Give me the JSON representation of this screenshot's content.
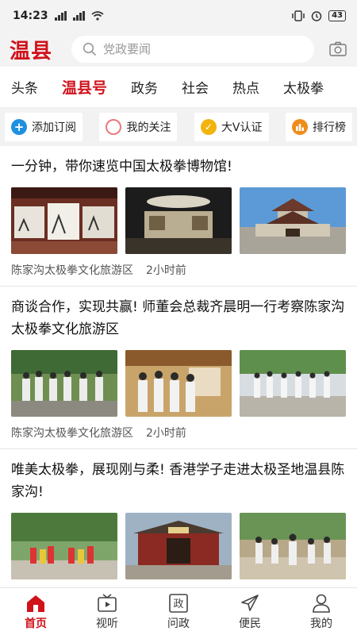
{
  "status_bar": {
    "time": "14:23",
    "signal1": "4G",
    "signal2": "4G",
    "battery": "43"
  },
  "header": {
    "logo": "温县",
    "search_placeholder": "党政要闻"
  },
  "tabs": [
    {
      "label": "头条"
    },
    {
      "label": "温县号"
    },
    {
      "label": "政务"
    },
    {
      "label": "社会"
    },
    {
      "label": "热点"
    },
    {
      "label": "太极拳"
    }
  ],
  "actions": [
    {
      "label": "添加订阅",
      "icon": "plus-icon",
      "color": "#1e90e0"
    },
    {
      "label": "我的关注",
      "icon": "circle-icon",
      "color": "#e9787c"
    },
    {
      "label": "大V认证",
      "icon": "verified-icon",
      "color": "#f2b30c"
    },
    {
      "label": "排行榜",
      "icon": "ranking-icon",
      "color": "#f08c1b"
    }
  ],
  "articles": [
    {
      "title": "一分钟，带你速览中国太极拳博物馆!",
      "source": "陈家沟太极拳文化旅游区",
      "time": "2小时前"
    },
    {
      "title": "商谈合作，实现共赢! 师董会总裁齐晨明一行考察陈家沟太极拳文化旅游区",
      "source": "陈家沟太极拳文化旅游区",
      "time": "2小时前"
    },
    {
      "title": "唯美太极拳，展现刚与柔! 香港学子走进太极圣地温县陈家沟!",
      "source": "",
      "time": ""
    }
  ],
  "bottom_nav": [
    {
      "label": "首页",
      "icon": "home-icon"
    },
    {
      "label": "视听",
      "icon": "tv-icon"
    },
    {
      "label": "问政",
      "icon": "politics-icon"
    },
    {
      "label": "便民",
      "icon": "paper-plane-icon"
    },
    {
      "label": "我的",
      "icon": "user-icon"
    }
  ],
  "colors": {
    "brand": "#d0121b",
    "bg_gray": "#f3f3f3"
  }
}
